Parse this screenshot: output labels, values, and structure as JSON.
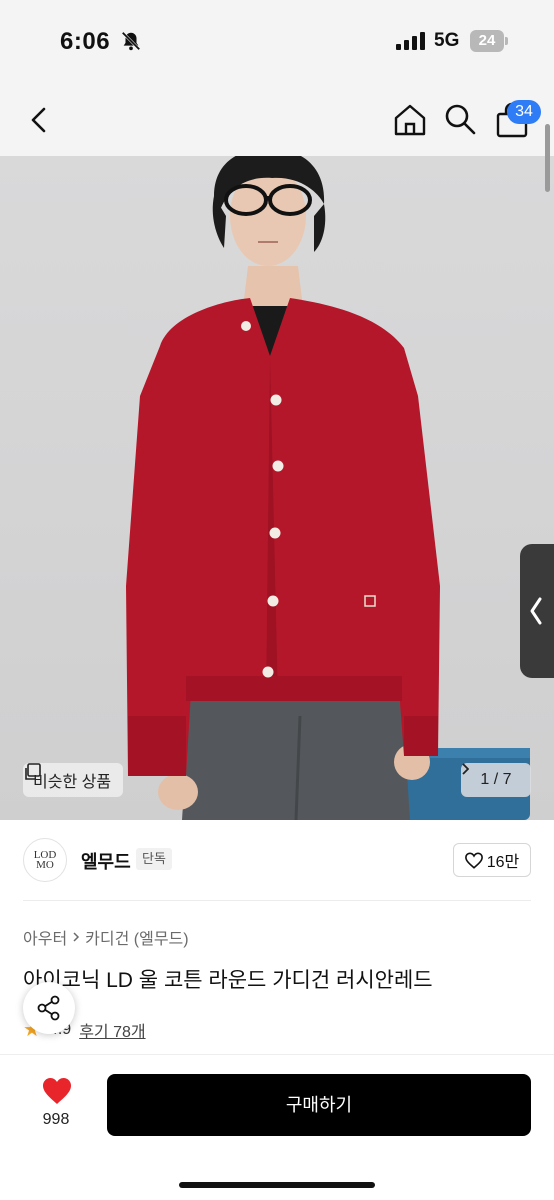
{
  "status_bar": {
    "time": "6:06",
    "network": "5G",
    "battery": "24",
    "icons": [
      "bell-off-icon",
      "signal-icon",
      "battery-icon"
    ]
  },
  "nav": {
    "icons": [
      "back-icon",
      "home-icon",
      "search-icon",
      "cart-icon"
    ],
    "cart_count": "34"
  },
  "hero": {
    "similar_label": "비슷한 상품",
    "pager": "1 / 7"
  },
  "brand": {
    "logo_line1": "LOD",
    "logo_line2": "MO",
    "name": "엘무드",
    "badge": "단독",
    "likes": "16만"
  },
  "product": {
    "breadcrumb": [
      "아우터",
      "카디건 (엘무드)"
    ],
    "title": "아이코닉 LD 울 코튼 라운드 가디건 러시안레드",
    "rating": "4.9",
    "reviews": "후기 78개"
  },
  "bottom": {
    "wish_count": "998",
    "buy_label": "구매하기"
  },
  "colors": {
    "accent_blue": "#2e7cf6",
    "cardigan_red": "#b5172a",
    "heart_red": "#e8252b",
    "star": "#f5a623",
    "buy_button": "#000000"
  }
}
